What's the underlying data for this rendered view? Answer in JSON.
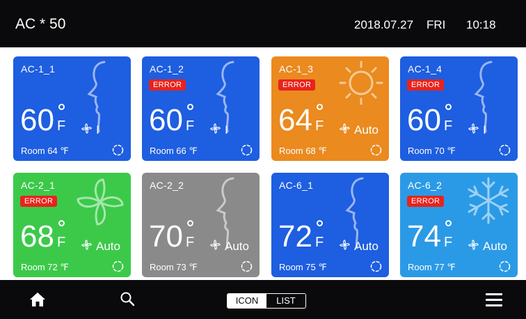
{
  "header": {
    "title": "AC * 50",
    "date": "2018.07.27",
    "day": "FRI",
    "time": "10:18"
  },
  "colors": {
    "blue": "#1e5ee0",
    "orange": "#ea8a1f",
    "green": "#3cc94a",
    "gray": "#8a8a8a",
    "light_blue": "#2b9ae6",
    "error": "#e8231c"
  },
  "cards": [
    {
      "name": "AC-1_1",
      "error": "",
      "temp": "60",
      "unit": "F",
      "fan_speed": "I",
      "room": "Room 64 ℉",
      "mode_icon": "face-icon",
      "color": "#1e5ee0"
    },
    {
      "name": "AC-1_2",
      "error": "ERROR",
      "temp": "60",
      "unit": "F",
      "fan_speed": "I",
      "room": "Room 66 ℉",
      "mode_icon": "face-icon",
      "color": "#1e5ee0"
    },
    {
      "name": "AC-1_3",
      "error": "ERROR",
      "temp": "64",
      "unit": "F",
      "fan_speed": "Auto",
      "room": "Room 68 ℉",
      "mode_icon": "sun-icon",
      "color": "#ea8a1f"
    },
    {
      "name": "AC-1_4",
      "error": "ERROR",
      "temp": "60",
      "unit": "F",
      "fan_speed": "I",
      "room": "Room 70 ℉",
      "mode_icon": "face-icon",
      "color": "#1e5ee0"
    },
    {
      "name": "AC-2_1",
      "error": "ERROR",
      "temp": "68",
      "unit": "F",
      "fan_speed": "Auto",
      "room": "Room 72 ℉",
      "mode_icon": "fan-mode-icon",
      "color": "#3cc94a"
    },
    {
      "name": "AC-2_2",
      "error": "",
      "temp": "70",
      "unit": "F",
      "fan_speed": "Auto",
      "room": "Room 73 ℉",
      "mode_icon": "face-icon",
      "color": "#8a8a8a"
    },
    {
      "name": "AC-6_1",
      "error": "",
      "temp": "72",
      "unit": "F",
      "fan_speed": "Auto",
      "room": "Room 75 ℉",
      "mode_icon": "face-icon",
      "color": "#1e5ee0"
    },
    {
      "name": "AC-6_2",
      "error": "ERROR",
      "temp": "74",
      "unit": "F",
      "fan_speed": "Auto",
      "room": "Room 77 ℉",
      "mode_icon": "snowflake-icon",
      "color": "#2b9ae6"
    }
  ],
  "footer": {
    "toggle_icon": "ICON",
    "toggle_list": "LIST",
    "icons": [
      "home-icon",
      "search-icon",
      "menu-icon"
    ]
  }
}
